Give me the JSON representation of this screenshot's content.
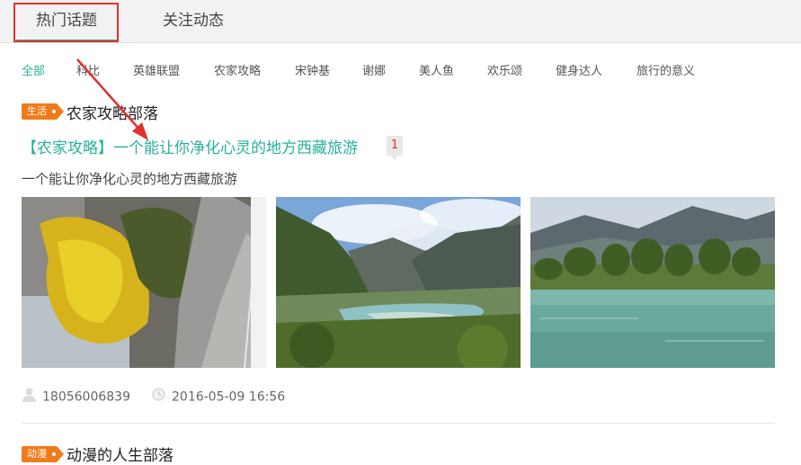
{
  "main_tabs": [
    {
      "label": "热门话题"
    },
    {
      "label": "关注动态"
    }
  ],
  "sub_tabs": [
    {
      "label": "全部"
    },
    {
      "label": "科比"
    },
    {
      "label": "英雄联盟"
    },
    {
      "label": "农家攻略"
    },
    {
      "label": "宋钟基"
    },
    {
      "label": "谢娜"
    },
    {
      "label": "美人鱼"
    },
    {
      "label": "欢乐颂"
    },
    {
      "label": "健身达人"
    },
    {
      "label": "旅行的意义"
    }
  ],
  "posts": [
    {
      "tag": "生活",
      "tribe": "农家攻略部落",
      "title": "【农家攻略】一个能让你净化心灵的地方西藏旅游",
      "comment_count": "1",
      "summary": "一个能让你净化心灵的地方西藏旅游",
      "author": "18056006839",
      "time": "2016-05-09 16:56"
    },
    {
      "tag": "动漫",
      "tribe": "动漫的人生部落"
    }
  ],
  "colors": {
    "accent": "#26b29a",
    "tag": "#f07b1a",
    "annotation_red": "#e2312c"
  },
  "icons": {
    "author": "user-icon",
    "time": "clock-icon"
  }
}
